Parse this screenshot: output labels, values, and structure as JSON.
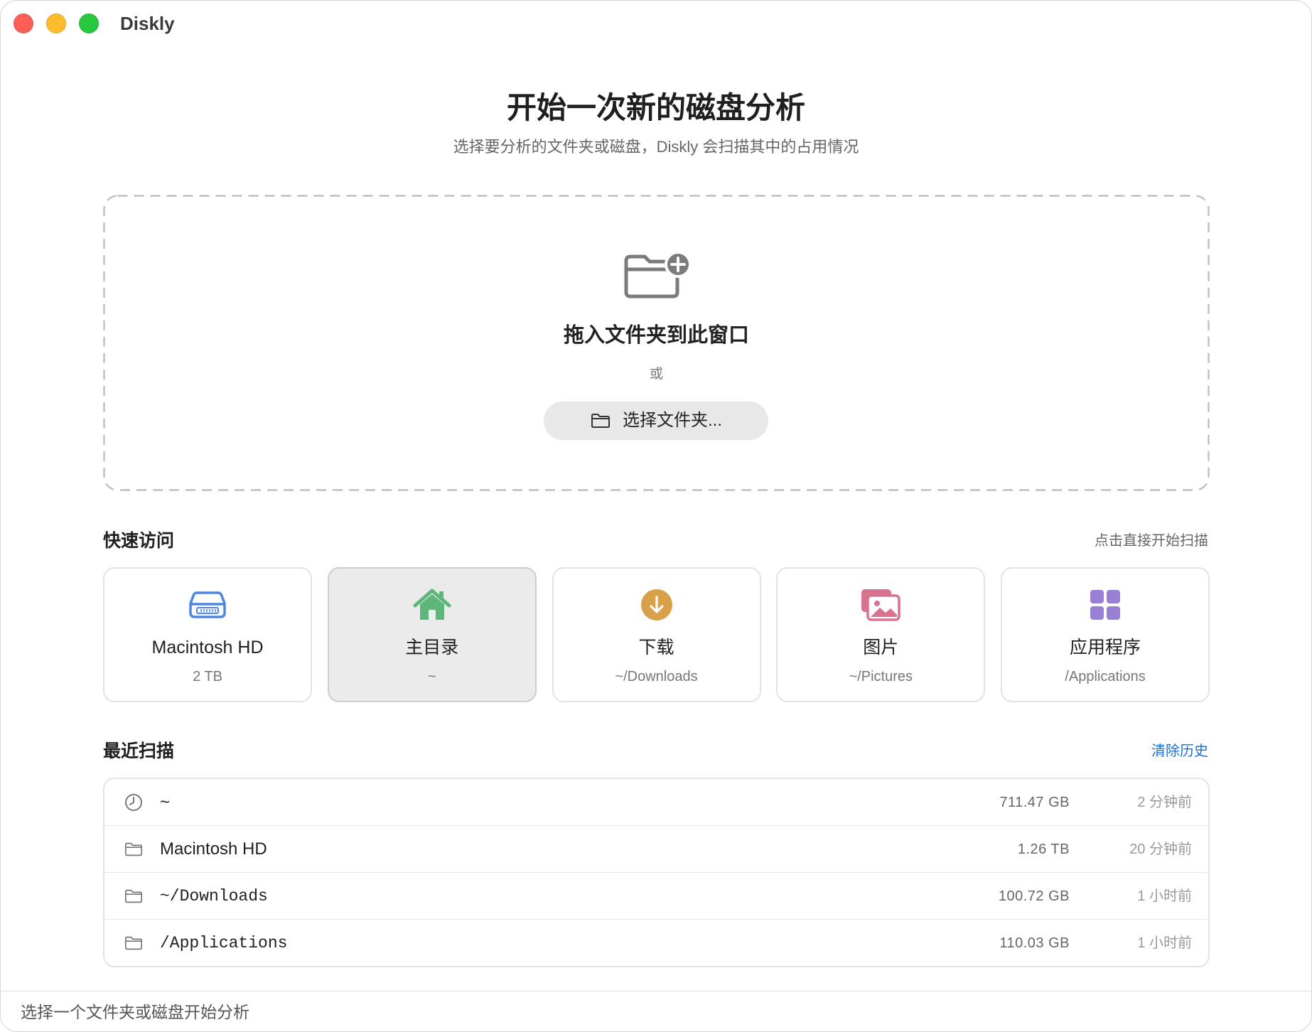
{
  "window": {
    "title": "Diskly",
    "traffic_lights": {
      "close_color": "#ff5f57",
      "minimize_color": "#febc2e",
      "zoom_color": "#28c840"
    }
  },
  "hero": {
    "title": "开始一次新的磁盘分析",
    "subtitle": "选择要分析的文件夹或磁盘，Diskly 会扫描其中的占用情况"
  },
  "drop_zone": {
    "icon": "folder-plus-icon",
    "icon_color": "#7b7b7b",
    "label": "拖入文件夹到此窗口",
    "or_text": "或",
    "choose_button": {
      "icon": "folder-icon",
      "label": "选择文件夹..."
    }
  },
  "quick_access": {
    "title": "快速访问",
    "hint": "点击直接开始扫描",
    "items": [
      {
        "title": "Macintosh HD",
        "subtitle": "2 TB",
        "icon": "hard-drive-icon",
        "color": "#4d86e0",
        "selected": false
      },
      {
        "title": "主目录",
        "subtitle": "~",
        "icon": "house-icon",
        "color": "#5db77a",
        "selected": true
      },
      {
        "title": "下载",
        "subtitle": "~/Downloads",
        "icon": "download-circle-icon",
        "color": "#d9a04a",
        "selected": false
      },
      {
        "title": "图片",
        "subtitle": "~/Pictures",
        "icon": "photos-icon",
        "color": "#d9728f",
        "selected": false
      },
      {
        "title": "应用程序",
        "subtitle": "/Applications",
        "icon": "app-grid-icon",
        "color": "#9a80d4",
        "selected": false
      }
    ]
  },
  "recent_scans": {
    "title": "最近扫描",
    "clear_label": "清除历史",
    "clear_color": "#1a6fd6",
    "rows": [
      {
        "icon": "clock-icon",
        "name": "~",
        "size": "711.47 GB",
        "time": "2 分钟前"
      },
      {
        "icon": "folder-icon",
        "name": "Macintosh HD",
        "size": "1.26 TB",
        "time": "20 分钟前"
      },
      {
        "icon": "folder-icon",
        "name": "~/Downloads",
        "size": "100.72 GB",
        "time": "1 小时前"
      },
      {
        "icon": "folder-icon",
        "name": "/Applications",
        "size": "110.03 GB",
        "time": "1 小时前"
      }
    ]
  },
  "status_bar": {
    "text": "选择一个文件夹或磁盘开始分析"
  }
}
